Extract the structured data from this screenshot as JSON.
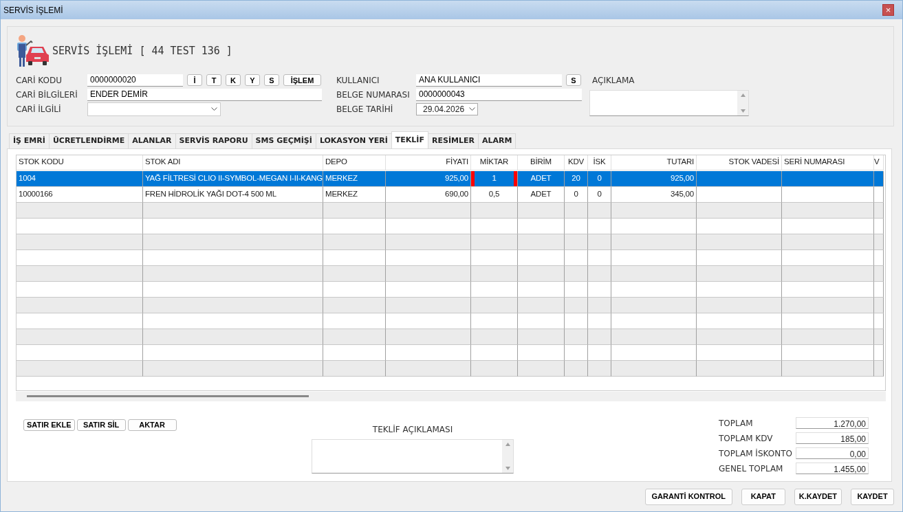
{
  "window": {
    "title": "SERVİS İŞLEMİ",
    "close": "×"
  },
  "header": {
    "title": "SERVİS İŞLEMİ [ 44 TEST 136 ]",
    "left_fields": [
      {
        "label": "CARİ KODU",
        "kind": "text",
        "value": "0000000020",
        "buttons": [
          "İ",
          "T",
          "K",
          "Y",
          "S",
          "İŞLEM"
        ]
      },
      {
        "label": "CARİ BİLGİLERİ",
        "kind": "text",
        "value": "ENDER DEMİR"
      },
      {
        "label": "CARİ İLGİLİ",
        "kind": "select"
      }
    ],
    "middle_fields": [
      {
        "label": "KULLANICI",
        "kind": "text",
        "value": "ANA KULLANICI",
        "buttons": [
          "S"
        ]
      },
      {
        "label": "BELGE NUMARASI",
        "kind": "text",
        "value": "0000000043"
      },
      {
        "label": "BELGE TARİHİ",
        "kind": "date",
        "value": "29.04.2026"
      }
    ],
    "note_label": "AÇIKLAMA"
  },
  "tabs": [
    {
      "label": "İŞ EMRİ",
      "selected": false
    },
    {
      "label": "ÜCRETLENDİRME",
      "selected": false
    },
    {
      "label": "ALANLAR",
      "selected": false
    },
    {
      "label": "SERVİS RAPORU",
      "selected": false
    },
    {
      "label": "SMS GEÇMİŞİ",
      "selected": false
    },
    {
      "label": "LOKASYON YERİ",
      "selected": false
    },
    {
      "label": "TEKLİF",
      "selected": true
    },
    {
      "label": "RESİMLER",
      "selected": false
    },
    {
      "label": "ALARM",
      "selected": false
    }
  ],
  "table": {
    "columns": [
      "STOK KODU",
      "STOK ADI",
      "DEPO",
      "FİYATI",
      "MİKTAR",
      "BİRİM",
      "KDV",
      "İSK",
      "TUTARI",
      "STOK VADESİ",
      "SERİ NUMARASI",
      "V"
    ],
    "rows": [
      {
        "selected": true,
        "editing": true,
        "cells": [
          "1004",
          "YAĞ FİLTRESİ CLIO II-SYMBOL-MEGAN I-II-KANG",
          "MERKEZ",
          "925,00",
          "1",
          "ADET",
          "20",
          "0",
          "925,00",
          null,
          null,
          null
        ]
      },
      {
        "selected": false,
        "editing": false,
        "cells": [
          "10000166",
          "FREN HİDROLİK YAĞI DOT-4 500 ML",
          "MERKEZ",
          "690,00",
          "0,5",
          "ADET",
          "0",
          "0",
          "345,00",
          null,
          null,
          null
        ]
      }
    ]
  },
  "row_buttons": [
    "SATIR EKLE",
    "SATIR SİL",
    "AKTAR"
  ],
  "offer_note_label": "TEKLİF AÇIKLAMASI",
  "totals": [
    {
      "label": "TOPLAM",
      "value": "1.270,00"
    },
    {
      "label": "TOPLAM KDV",
      "value": "185,00"
    },
    {
      "label": "TOPLAM İSKONTO",
      "value": "0,00"
    },
    {
      "label": "GENEL TOPLAM",
      "value": "1.455,00"
    }
  ],
  "footer_buttons": [
    "GARANTİ KONTROL",
    "KAPAT",
    "K.KAYDET",
    "KAYDET"
  ]
}
